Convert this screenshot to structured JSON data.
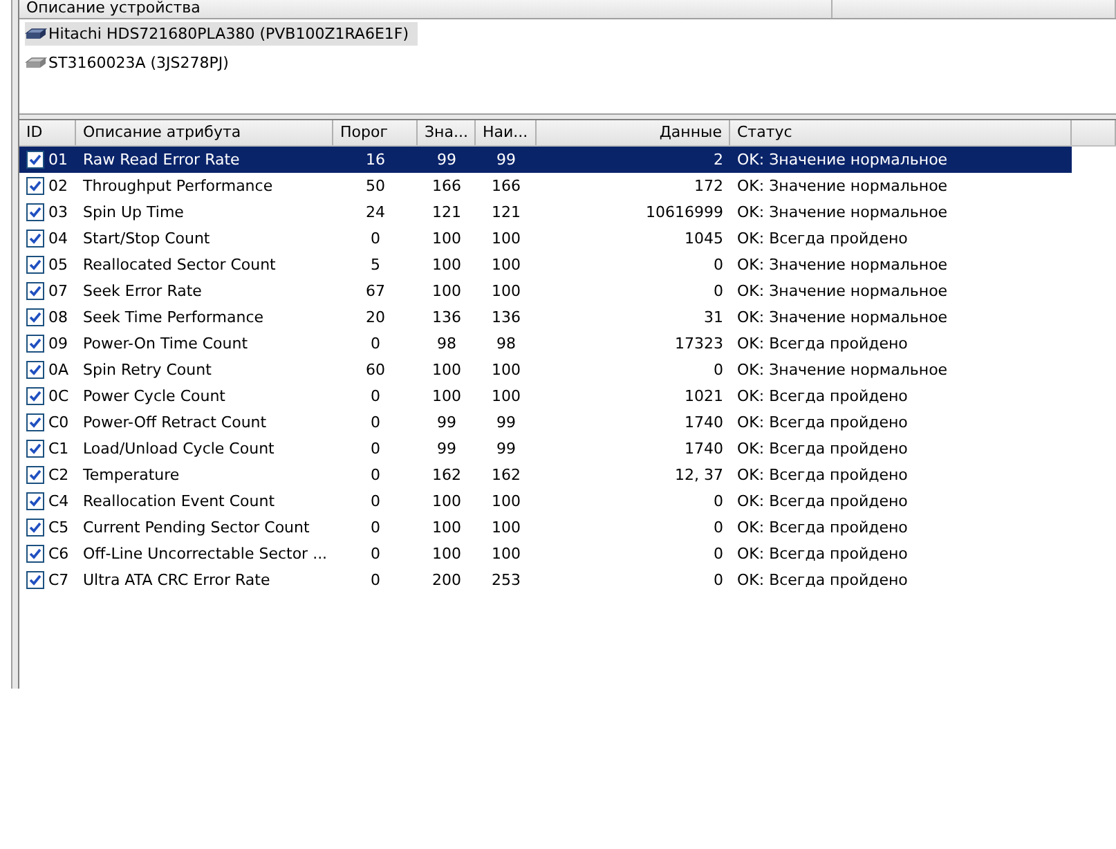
{
  "devices_header": "Описание устройства",
  "devices": [
    {
      "label": "Hitachi HDS721680PLA380 (PVB100Z1RA6E1F)",
      "selected": true
    },
    {
      "label": "ST3160023A (3JS278PJ)",
      "selected": false
    }
  ],
  "table": {
    "columns": [
      "ID",
      "Описание атрибута",
      "Порог",
      "Зна...",
      "Наи...",
      "Данные",
      "Статус"
    ],
    "rows": [
      {
        "checked": true,
        "selected": true,
        "id": "01",
        "name": "Raw Read Error Rate",
        "threshold": "16",
        "value": "99",
        "worst": "99",
        "data": "2",
        "status": "OK: Значение нормальное"
      },
      {
        "checked": true,
        "selected": false,
        "id": "02",
        "name": "Throughput Performance",
        "threshold": "50",
        "value": "166",
        "worst": "166",
        "data": "172",
        "status": "OK: Значение нормальное"
      },
      {
        "checked": true,
        "selected": false,
        "id": "03",
        "name": "Spin Up Time",
        "threshold": "24",
        "value": "121",
        "worst": "121",
        "data": "10616999",
        "status": "OK: Значение нормальное"
      },
      {
        "checked": true,
        "selected": false,
        "id": "04",
        "name": "Start/Stop Count",
        "threshold": "0",
        "value": "100",
        "worst": "100",
        "data": "1045",
        "status": "OK: Всегда пройдено"
      },
      {
        "checked": true,
        "selected": false,
        "id": "05",
        "name": "Reallocated Sector Count",
        "threshold": "5",
        "value": "100",
        "worst": "100",
        "data": "0",
        "status": "OK: Значение нормальное"
      },
      {
        "checked": true,
        "selected": false,
        "id": "07",
        "name": "Seek Error Rate",
        "threshold": "67",
        "value": "100",
        "worst": "100",
        "data": "0",
        "status": "OK: Значение нормальное"
      },
      {
        "checked": true,
        "selected": false,
        "id": "08",
        "name": "Seek Time Performance",
        "threshold": "20",
        "value": "136",
        "worst": "136",
        "data": "31",
        "status": "OK: Значение нормальное"
      },
      {
        "checked": true,
        "selected": false,
        "id": "09",
        "name": "Power-On Time Count",
        "threshold": "0",
        "value": "98",
        "worst": "98",
        "data": "17323",
        "status": "OK: Всегда пройдено"
      },
      {
        "checked": true,
        "selected": false,
        "id": "0A",
        "name": "Spin Retry Count",
        "threshold": "60",
        "value": "100",
        "worst": "100",
        "data": "0",
        "status": "OK: Значение нормальное"
      },
      {
        "checked": true,
        "selected": false,
        "id": "0C",
        "name": "Power Cycle Count",
        "threshold": "0",
        "value": "100",
        "worst": "100",
        "data": "1021",
        "status": "OK: Всегда пройдено"
      },
      {
        "checked": true,
        "selected": false,
        "id": "C0",
        "name": "Power-Off Retract Count",
        "threshold": "0",
        "value": "99",
        "worst": "99",
        "data": "1740",
        "status": "OK: Всегда пройдено"
      },
      {
        "checked": true,
        "selected": false,
        "id": "C1",
        "name": "Load/Unload Cycle Count",
        "threshold": "0",
        "value": "99",
        "worst": "99",
        "data": "1740",
        "status": "OK: Всегда пройдено"
      },
      {
        "checked": true,
        "selected": false,
        "id": "C2",
        "name": "Temperature",
        "threshold": "0",
        "value": "162",
        "worst": "162",
        "data": "12, 37",
        "status": "OK: Всегда пройдено"
      },
      {
        "checked": true,
        "selected": false,
        "id": "C4",
        "name": "Reallocation Event Count",
        "threshold": "0",
        "value": "100",
        "worst": "100",
        "data": "0",
        "status": "OK: Всегда пройдено"
      },
      {
        "checked": true,
        "selected": false,
        "id": "C5",
        "name": "Current Pending Sector Count",
        "threshold": "0",
        "value": "100",
        "worst": "100",
        "data": "0",
        "status": "OK: Всегда пройдено"
      },
      {
        "checked": true,
        "selected": false,
        "id": "C6",
        "name": "Off-Line Uncorrectable Sector ...",
        "threshold": "0",
        "value": "100",
        "worst": "100",
        "data": "0",
        "status": "OK: Всегда пройдено"
      },
      {
        "checked": true,
        "selected": false,
        "id": "C7",
        "name": "Ultra ATA CRC Error Rate",
        "threshold": "0",
        "value": "200",
        "worst": "253",
        "data": "0",
        "status": "OK: Всегда пройдено"
      }
    ]
  }
}
